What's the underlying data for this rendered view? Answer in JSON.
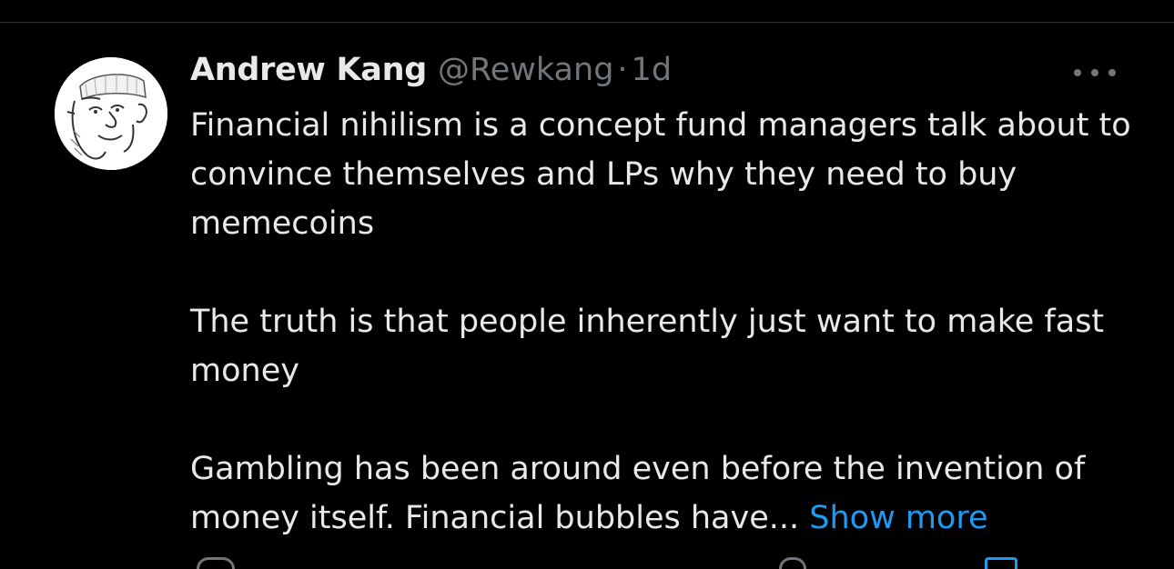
{
  "tweet": {
    "author": {
      "display_name": "Andrew Kang",
      "handle": "@Rewkang",
      "separator": "·",
      "time": "1d",
      "avatar_icon": "sketch-face-avatar"
    },
    "more_icon": "more-horizontal-icon",
    "text": {
      "paragraph_1": "Financial nihilism is a concept fund managers talk about to convince themselves and LPs why they need to buy memecoins",
      "paragraph_2": "The truth is that people inherently just want to make fast money",
      "paragraph_3": "Gambling has been around even before the invention of money itself. Financial bubbles have...",
      "show_more": "Show more"
    },
    "colors": {
      "background": "#000000",
      "primary_text": "#e7e9ea",
      "secondary_text": "#71767b",
      "link": "#1d9bf0",
      "divider": "#2f3336"
    }
  }
}
